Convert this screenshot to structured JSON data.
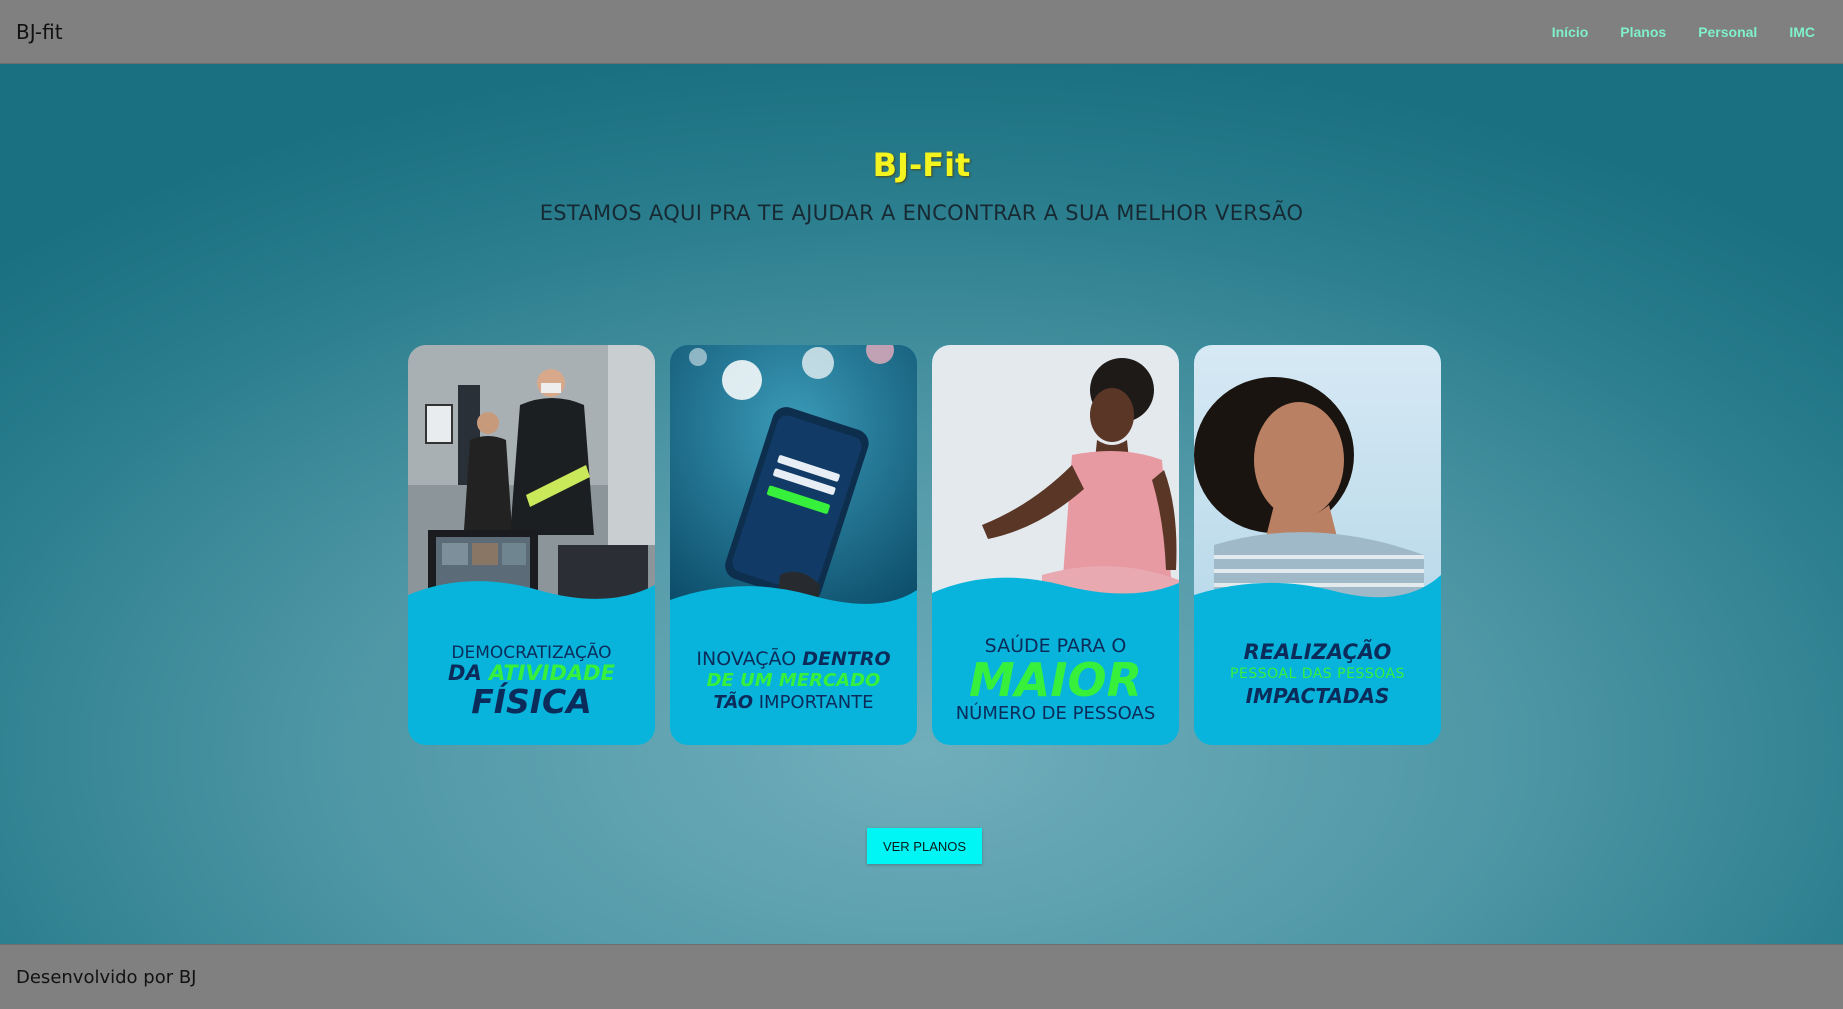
{
  "header": {
    "brand": "BJ-fit",
    "nav": [
      "Início",
      "Planos",
      "Personal",
      "IMC"
    ]
  },
  "hero": {
    "title": "BJ-Fit",
    "subtitle": "ESTAMOS AQUI PRA TE AJUDAR A ENCONTRAR A SUA MELHOR VERSÃO"
  },
  "cards": [
    {
      "lines": [
        "DEMOCRATIZAÇÃO",
        "DA",
        "ATIVIDADE",
        "FÍSICA"
      ]
    },
    {
      "lines": [
        "INOVAÇÃO",
        "DENTRO",
        "DE UM MERCADO",
        "TÃO",
        "IMPORTANTE"
      ]
    },
    {
      "lines": [
        "SAÚDE PARA O",
        "MAIOR",
        "NÚMERO DE PESSOAS"
      ]
    },
    {
      "lines": [
        "REALIZAÇÃO",
        "PESSOAL DAS PESSOAS",
        "IMPACTADAS"
      ]
    }
  ],
  "cta": {
    "label": "VER PLANOS"
  },
  "footer": {
    "text": "Desenvolvido por BJ"
  },
  "colors": {
    "accent_title": "#f4f51e",
    "nav_link": "#7ff0c8",
    "button": "#00f5f5",
    "card_blue": "#08b4db",
    "card_green": "#37f03c",
    "card_navy": "#0b2c5a"
  }
}
